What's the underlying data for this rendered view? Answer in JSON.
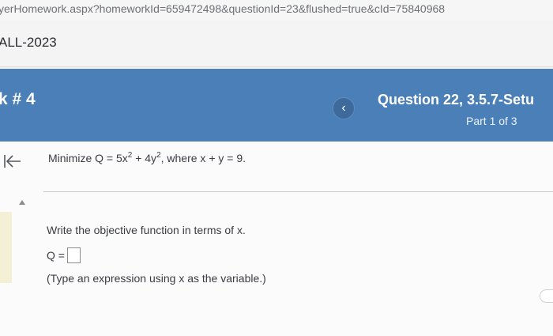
{
  "browser": {
    "url": "yerHomework.aspx?homeworkId=659472498&questionId=23&flushed=true&cId=75840968"
  },
  "course": {
    "term": "ALL-2023"
  },
  "header": {
    "homework_title": "k # 4",
    "prev_icon": "chevron-left-icon",
    "prev_symbol": "‹",
    "question_title": "Question 22, 3.5.7-Setu",
    "part_label": "Part 1 of 3"
  },
  "question": {
    "prompt_prefix": "Minimize Q = 5x",
    "exp1": "2",
    "prompt_mid": " + 4y",
    "exp2": "2",
    "prompt_suffix": ", where x + y = 9.",
    "instruction": "Write the objective function in terms of x.",
    "answer_label": "Q =",
    "answer_value": "",
    "hint": "(Type an expression using x as the variable.)"
  },
  "colors": {
    "header_blue": "#4a7fb8",
    "text": "#3a3c42"
  }
}
